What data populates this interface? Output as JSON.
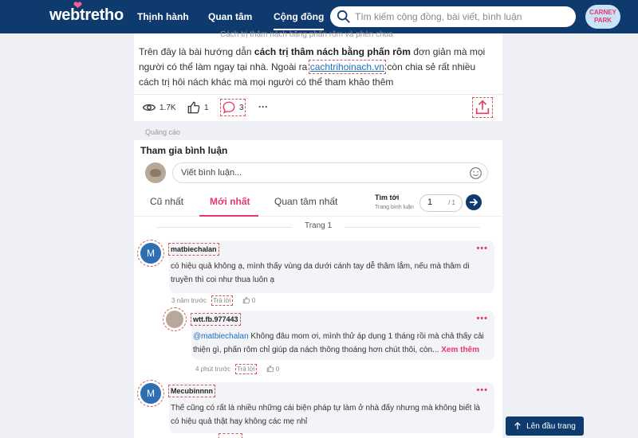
{
  "header": {
    "logo": "webtretho",
    "nav": [
      {
        "label": "Thịnh hành"
      },
      {
        "label": "Quan tâm"
      },
      {
        "label": "Cộng đồng"
      }
    ],
    "search_placeholder": "Tìm kiếm cộng đồng, bài viết, bình luận",
    "badge_text": "CARNEY PARK"
  },
  "article": {
    "faded_caption": "Cách trị thâm nách bằng phấn rôm và phèn chua",
    "text_before": "Trên đây là bài hướng dẫn ",
    "text_bold": "cách trị thâm nách bằng phấn rôm",
    "text_mid": " đơn giản mà mọi người có thể làm ngay tại nhà. Ngoài ra ",
    "link": "cachtrihoinach.vn",
    "text_after": " còn chia sẻ rất nhiều cách trị hôi nách khác mà mọi người có thể tham khảo thêm",
    "views": "1.7K",
    "likes": "1",
    "comments": "3",
    "more": "···"
  },
  "ad_label": "Quảng cáo",
  "comments_section": {
    "title": "Tham gia bình luận",
    "input_placeholder": "Viết bình luận...",
    "tabs": [
      "Cũ nhất",
      "Mới nhất",
      "Quan tâm nhất"
    ],
    "goto_label": "Tìm tới",
    "goto_sub": "Trang bình luận",
    "page_value": "1",
    "page_total": "/ 1",
    "page_indicator": "Trang 1",
    "items": [
      {
        "avatar_letter": "M",
        "user": "matbiechalan",
        "line1": "có hiệu quả không ạ, mình thấy vùng da dưới cánh tay dễ thâm lắm, nếu mà thâm di",
        "line2": "truyền thì coi như thua luôn ạ",
        "time": "3 năm trước",
        "reply": "Trả lời",
        "likes": "0"
      },
      {
        "user": "wtt.fb.977443",
        "mention": "@matbiechalan",
        "line1_rest": " Không đâu mom ơi, mình thử áp dụng 1 tháng rồi mà chả thấy cải",
        "line2": "thiện gì, phấn rôm chỉ giúp da nách thông thoáng hơn chút thôi, còn...",
        "see_more": "Xem thêm",
        "time": "4 phút trước",
        "reply": "Trả lời",
        "likes": "0"
      },
      {
        "avatar_letter": "M",
        "user": "Mecubinnnn",
        "line1": "Thế cũng có rất là nhiều những cái biện pháp tự làm ở nhà đấy nhưng mà không biết là",
        "line2": "có hiệu quả thật hay không các mẹ nhỉ"
      }
    ],
    "dots": "•••"
  },
  "back_to_top": "Lên đầu trang",
  "colors": {
    "header": "#0f3a6e",
    "accent": "#e6386c",
    "link": "#1f6fc0"
  }
}
